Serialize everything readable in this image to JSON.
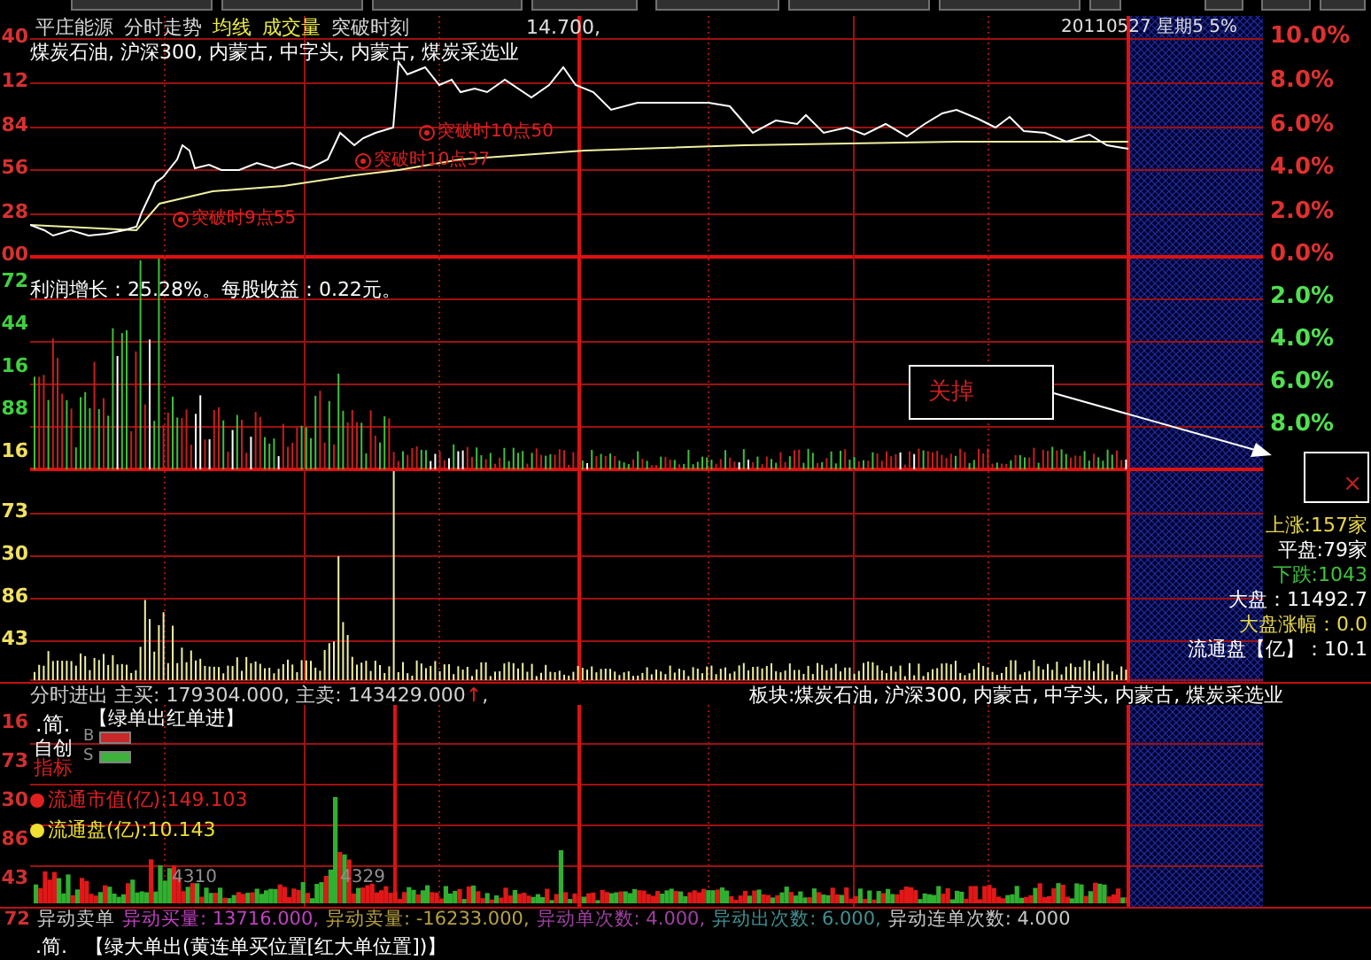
{
  "header": {
    "items": [
      {
        "label": "平庄能源",
        "color": "#d8d8d8"
      },
      {
        "label": "分时走势",
        "color": "#d8d8d8"
      },
      {
        "label": "均线",
        "color": "#f0f040"
      },
      {
        "label": "成交量",
        "color": "#f0f040"
      },
      {
        "label": "突破时刻",
        "color": "#d8d8d8"
      }
    ],
    "price": "14.700,",
    "date": "20110527 星期5 5%"
  },
  "sectors": "煤炭石油, 沪深300, 内蒙古, 中字头, 内蒙古, 煤炭采选业",
  "price_panel": {
    "left_ticks": [
      "40",
      "12",
      "84",
      "56",
      "28",
      "00"
    ],
    "right_ticks": [
      "10.0%",
      "8.0%",
      "6.0%",
      "4.0%",
      "2.0%",
      "0.0%"
    ],
    "breakouts": [
      "突破时9点55",
      "突破时10点37",
      "突破时10点50"
    ]
  },
  "volume_panel": {
    "note": "利润增长：25.28%。每股收益：0.22元。",
    "left_ticks": [
      {
        "text": "72",
        "color": "#40d040"
      },
      {
        "text": "44",
        "color": "#40d040"
      },
      {
        "text": "16",
        "color": "#40d040"
      },
      {
        "text": "88",
        "color": "#40d040"
      },
      {
        "text": "16",
        "color": "#f0e060"
      }
    ],
    "right_ticks": [
      "2.0%",
      "4.0%",
      "6.0%",
      "8.0%"
    ]
  },
  "callout": {
    "label": "关掉",
    "close": "×"
  },
  "market_panel": {
    "left_ticks": [
      "73",
      "30",
      "86",
      "43"
    ],
    "stats": [
      {
        "text": "上涨:157家",
        "color": "#e8d84a"
      },
      {
        "text": "平盘:79家",
        "color": "#ffffff"
      },
      {
        "text": "下跌:1043",
        "color": "#3ec43e"
      },
      {
        "text": "大盘：11492.7",
        "color": "#ffffff"
      },
      {
        "text": "大盘涨幅：0.0",
        "color": "#e8d84a"
      },
      {
        "text": "流通盘【亿】：10.1",
        "color": "#ffffff"
      }
    ]
  },
  "flow": {
    "label": "分时进出",
    "summary": "主买: 179304.000, 主卖: 143429.000",
    "arrow": "↑",
    "tail": ","
  },
  "board": "板块:煤炭石油, 沪深300, 内蒙古, 中字头, 内蒙古, 煤炭采选业",
  "indicator_panel": {
    "left_ticks": [
      "16",
      "73",
      "30",
      "86",
      "43"
    ],
    "mode": ".简.",
    "title": "【绿单出红单进】",
    "legend": [
      {
        "label": "B",
        "color": "#c82828"
      },
      {
        "label": "S",
        "color": "#3cb43c"
      }
    ],
    "menu": [
      {
        "label": "自创",
        "color": "#ffffff"
      },
      {
        "label": "指标",
        "color": "#d02020"
      }
    ],
    "metrics": [
      {
        "label": "流通市值(亿):149.103",
        "color": "#e02020"
      },
      {
        "label": "流通盘(亿):10.143",
        "color": "#f0e030"
      }
    ],
    "bar_labels": [
      "4310",
      "4329"
    ]
  },
  "anomaly_row": {
    "left_tick": "72",
    "parts": [
      {
        "text": "异动卖单",
        "color": "#c8c8c8"
      },
      {
        "text": "异动买量: 13716.000,",
        "color": "#c040c0"
      },
      {
        "text": "异动卖量: -16233.000,",
        "color": "#b8a040"
      },
      {
        "text": "异动单次数: 4.000,",
        "color": "#a040a0"
      },
      {
        "text": "异动出次数: 6.000,",
        "color": "#409090"
      },
      {
        "text": "异动连单次数: 4.000",
        "color": "#c8c8c8"
      }
    ]
  },
  "footer": {
    "mode": ".简.",
    "text": "【绿大单出(黄连单买位置[红大单位置])】"
  }
}
